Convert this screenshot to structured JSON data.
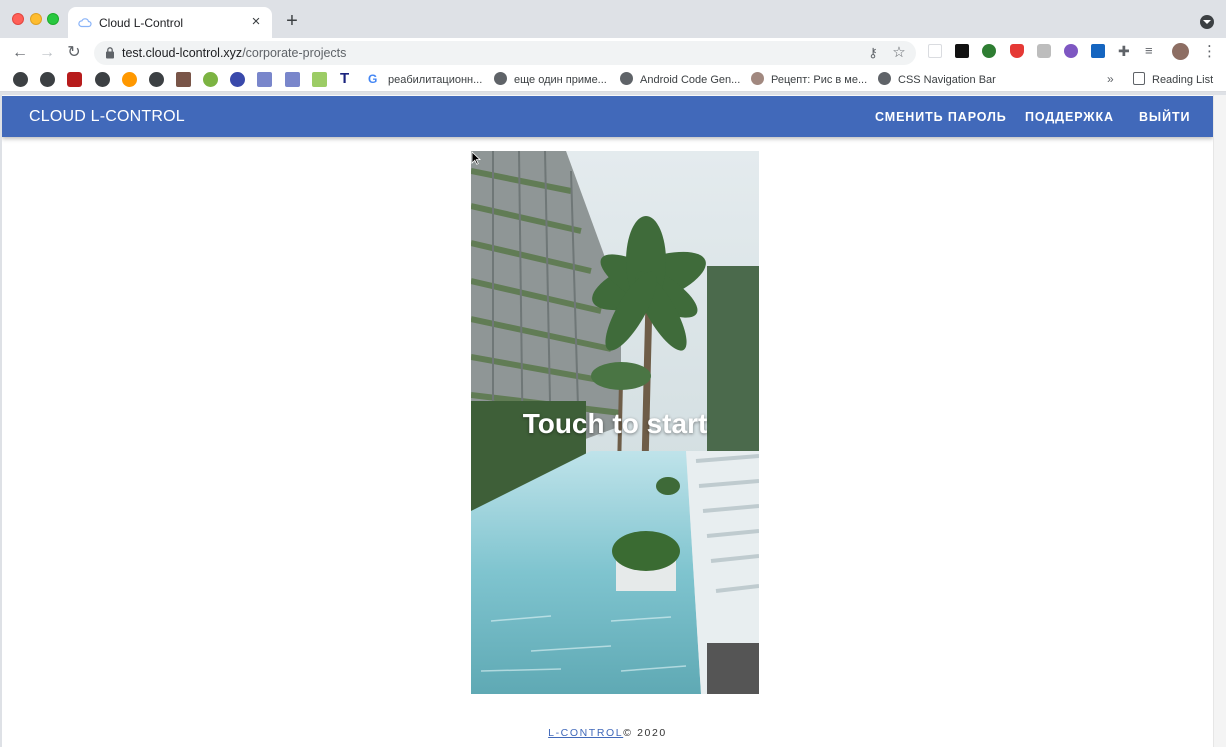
{
  "browser": {
    "tab_title": "Cloud L-Control",
    "url_host": "test.cloud-lcontrol.xyz",
    "url_path": "/corporate-projects",
    "bookmarks": [
      {
        "label": "реабилитационн..."
      },
      {
        "label": "еще один приме..."
      },
      {
        "label": "Android Code Gen..."
      },
      {
        "label": "Рецепт: Рис в ме..."
      },
      {
        "label": "CSS Navigation Bar"
      }
    ],
    "bookmarks_more": "»",
    "reading_list": "Reading List"
  },
  "app": {
    "brand": "CLOUD L-CONTROL",
    "nav": {
      "change_password": "СМЕНИТЬ ПАРОЛЬ",
      "support": "ПОДДЕРЖКА",
      "logout": "ВЫЙТИ"
    },
    "accent_color": "#4169ba",
    "viewer": {
      "overlay_text": "Touch to start"
    },
    "footer": {
      "link": "L-CONTROL",
      "text": "© 2020"
    }
  }
}
